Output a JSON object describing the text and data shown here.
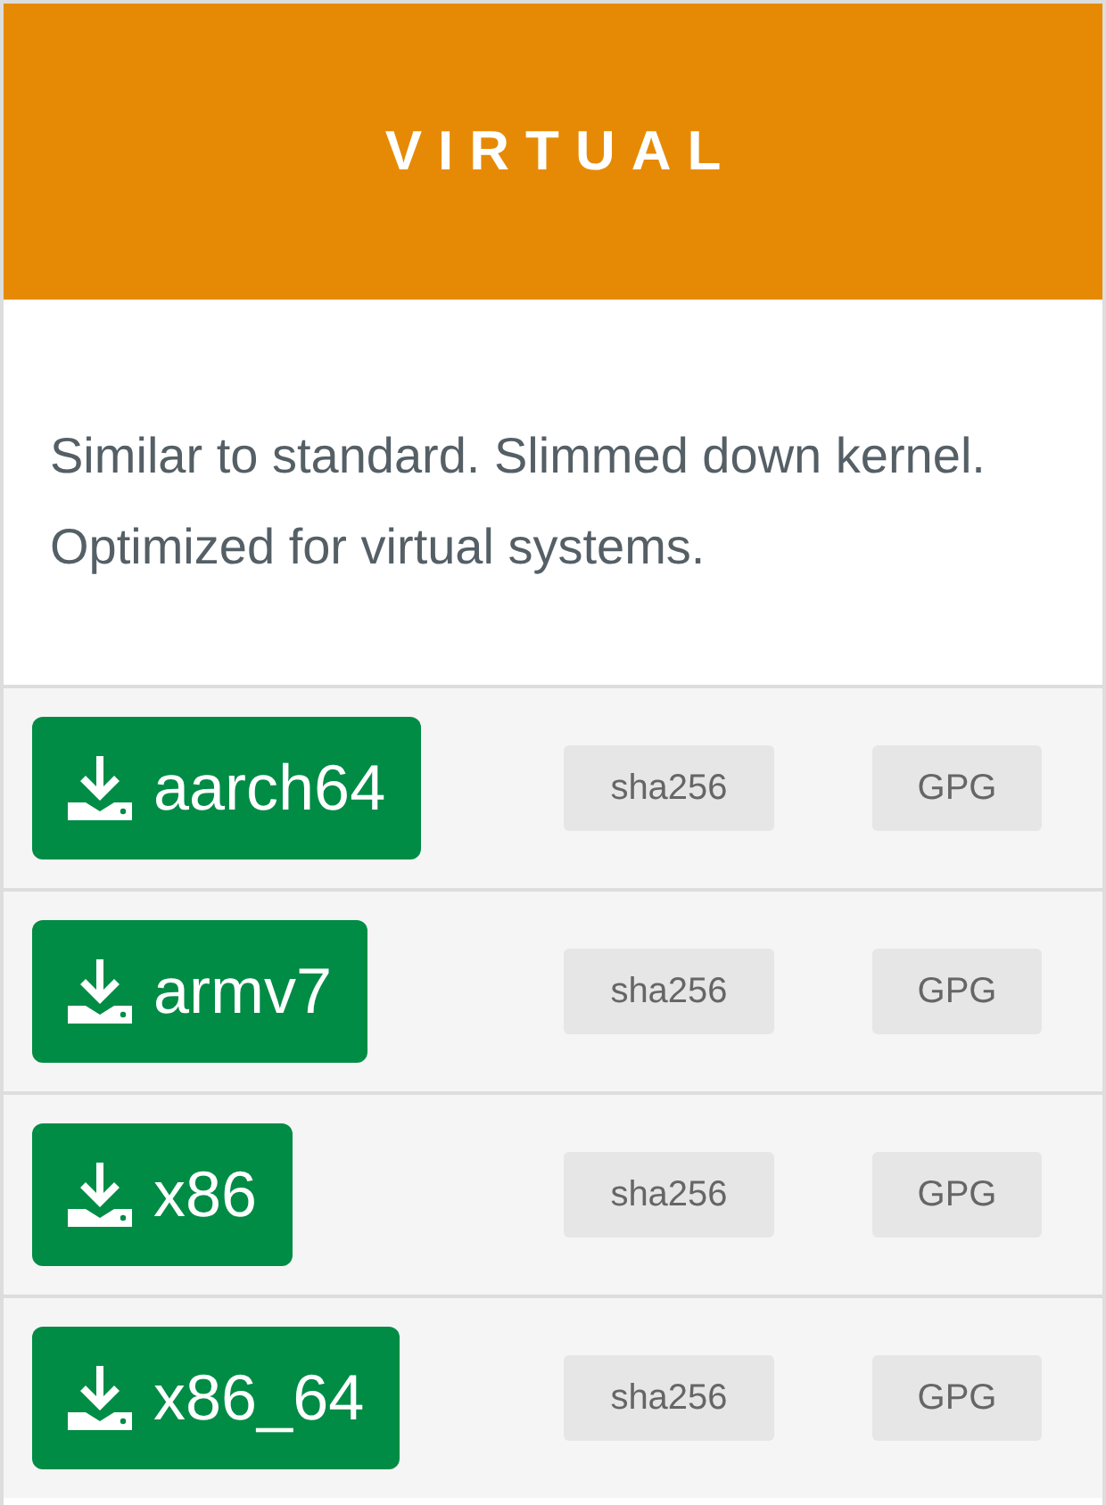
{
  "header": {
    "title": "VIRTUAL"
  },
  "description": "Similar to standard. Slimmed down kernel. Optimized for virtual systems.",
  "downloads": [
    {
      "arch": "aarch64",
      "checksum": "sha256",
      "signature": "GPG"
    },
    {
      "arch": "armv7",
      "checksum": "sha256",
      "signature": "GPG"
    },
    {
      "arch": "x86",
      "checksum": "sha256",
      "signature": "GPG"
    },
    {
      "arch": "x86_64",
      "checksum": "sha256",
      "signature": "GPG"
    }
  ]
}
